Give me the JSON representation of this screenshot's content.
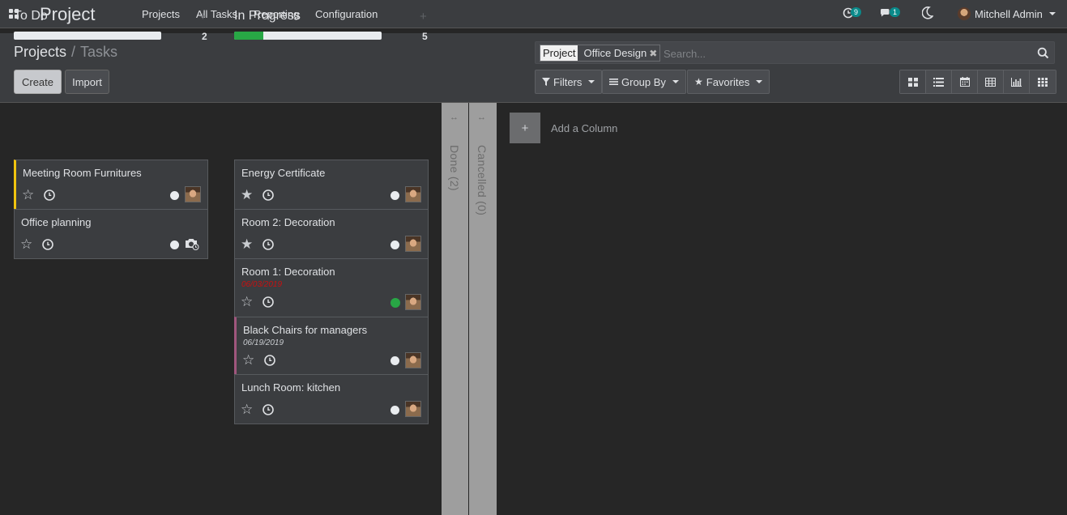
{
  "app": {
    "title": "Project"
  },
  "nav": {
    "menus": [
      "Projects",
      "All Tasks",
      "Reporting",
      "Configuration"
    ]
  },
  "systray": {
    "activity_count": "9",
    "messages_count": "1",
    "user_name": "Mitchell Admin"
  },
  "breadcrumb": {
    "root": "Projects",
    "separator": "/",
    "current": "Tasks"
  },
  "buttons": {
    "create": "Create",
    "import": "Import"
  },
  "search": {
    "facet_label": "Project",
    "facet_value": "Office Design",
    "placeholder": "Search..."
  },
  "filters": {
    "filters": "Filters",
    "group_by": "Group By",
    "favorites": "Favorites"
  },
  "views": [
    "kanban",
    "list",
    "calendar",
    "pivot",
    "graph",
    "grid"
  ],
  "kanban": {
    "columns": [
      {
        "title": "To Do",
        "count": "2",
        "progress": 0,
        "cards": [
          {
            "title": "Meeting Room Furnitures",
            "date": "",
            "starred": false,
            "status": "normal"
          },
          {
            "title": "Office planning",
            "date": "",
            "starred": false,
            "status": "normal"
          }
        ]
      },
      {
        "title": "In Progress",
        "count": "5",
        "progress": 0.2,
        "cards": [
          {
            "title": "Energy Certificate",
            "date": "",
            "starred": true,
            "status": "normal"
          },
          {
            "title": "Room 2: Decoration",
            "date": "",
            "starred": true,
            "status": "normal"
          },
          {
            "title": "Room 1: Decoration",
            "date": "06/03/2019",
            "starred": false,
            "status": "done"
          },
          {
            "title": "Black Chairs for managers",
            "date": "06/19/2019",
            "starred": false,
            "status": "normal"
          },
          {
            "title": "Lunch Room: kitchen",
            "date": "",
            "starred": false,
            "status": "normal"
          }
        ]
      }
    ],
    "folded": [
      {
        "title": "Done (2)"
      },
      {
        "title": "Cancelled (0)"
      }
    ],
    "add_column": {
      "plus": "+",
      "label": "Add a Column"
    }
  },
  "colors": {
    "todo_accent": "#f1c40f",
    "blocked_accent": "#a0567d",
    "progress_green": "#28a745"
  }
}
